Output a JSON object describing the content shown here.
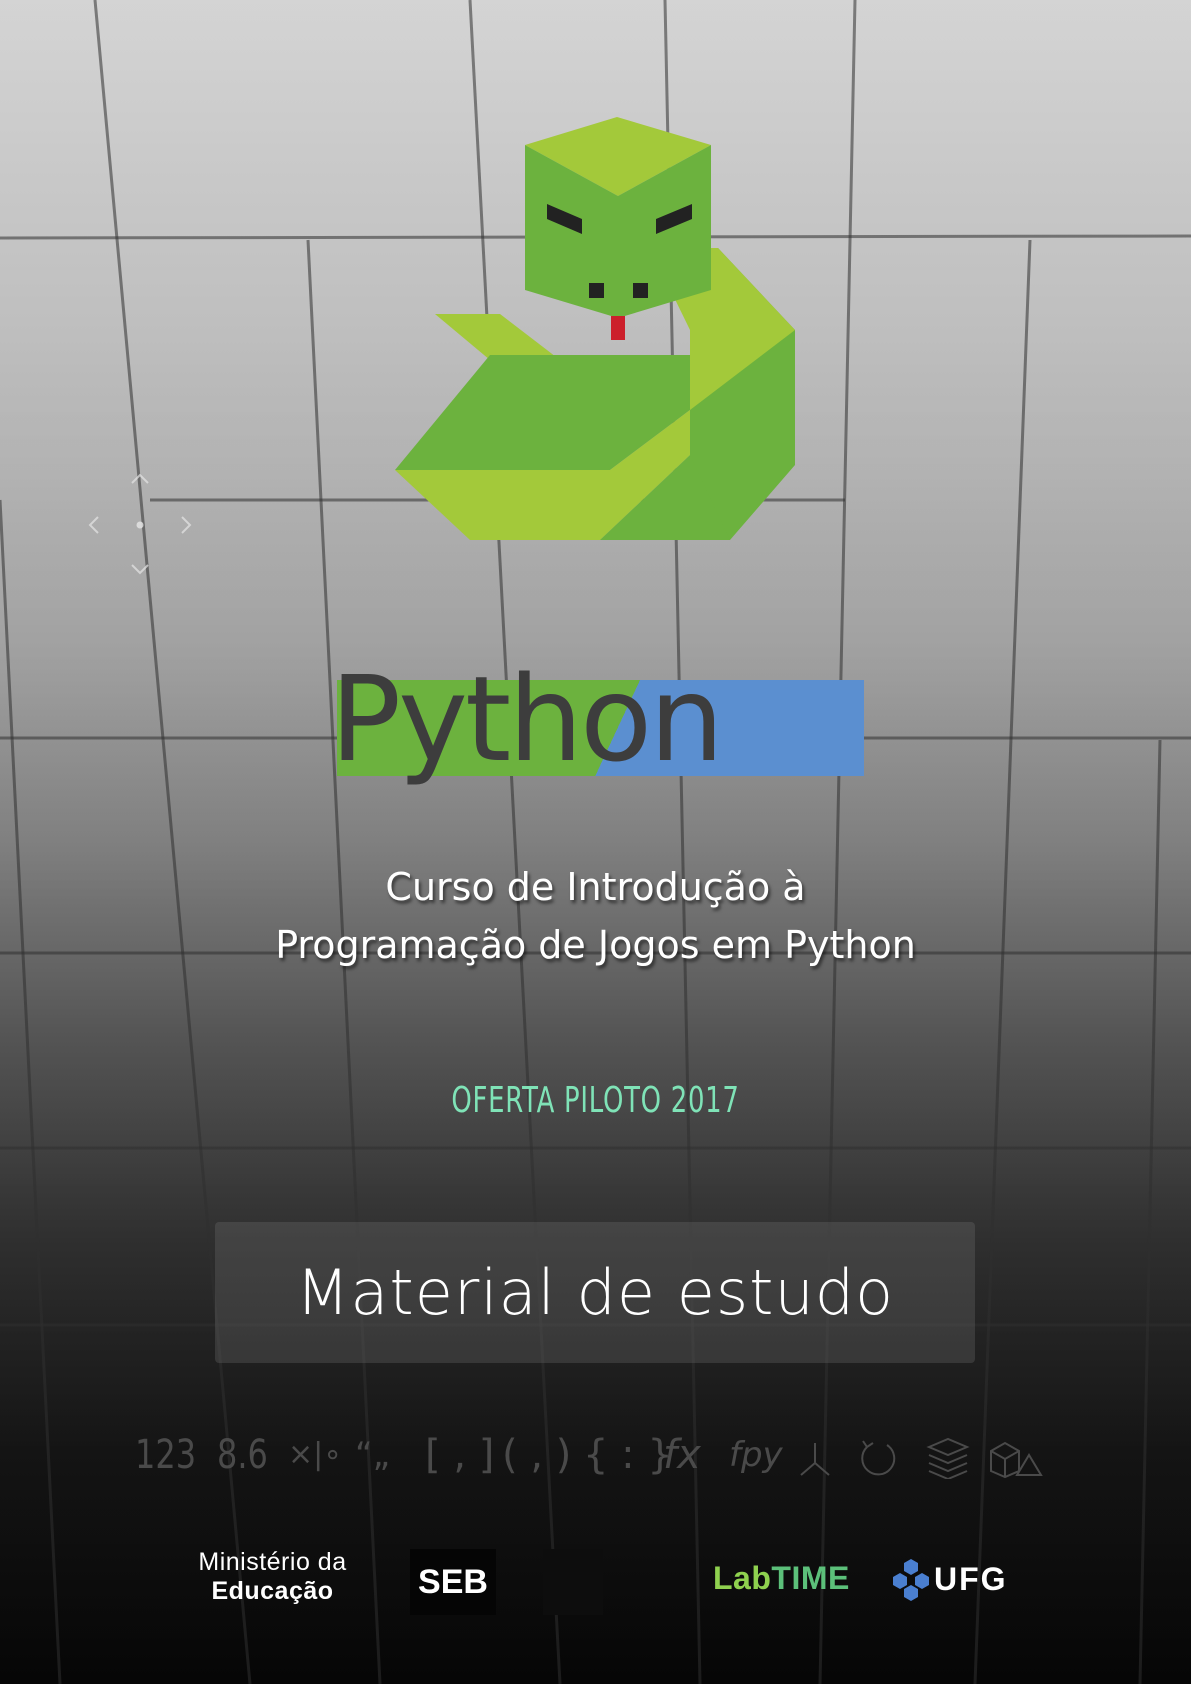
{
  "cover": {
    "wordmark": "Python",
    "course_title_line1": "Curso de Introdução à",
    "course_title_line2": "Programação de Jogos em Python",
    "edition": "OFERTA PILOTO 2017",
    "material_label": "Material de estudo"
  },
  "nav_control": {
    "up": "chevron-up-icon",
    "down": "chevron-down-icon",
    "left": "chevron-left-icon",
    "right": "chevron-right-icon",
    "center": "dot-icon"
  },
  "symbols": [
    {
      "label": "123",
      "icon": "integer-icon"
    },
    {
      "label": "8.6",
      "icon": "float-icon"
    },
    {
      "label": "×|∘",
      "icon": "operators-icon"
    },
    {
      "label": "“”",
      "icon": "string-icon"
    },
    {
      "label": "[ , ]",
      "icon": "list-icon"
    },
    {
      "label": "( , )",
      "icon": "tuple-icon"
    },
    {
      "label": "{ : }",
      "icon": "dict-icon"
    },
    {
      "label": "fx",
      "icon": "function-icon"
    },
    {
      "label": "fpy",
      "icon": "python-function-icon"
    },
    {
      "label": "branch",
      "icon": "branch-icon"
    },
    {
      "label": "loop",
      "icon": "loop-icon"
    },
    {
      "label": "stack",
      "icon": "stack-icon"
    },
    {
      "label": "shapes",
      "icon": "shapes-icon"
    }
  ],
  "footer": {
    "ministry_line1": "Ministério da",
    "ministry_line2": "Educação",
    "seb": "SEB",
    "labtime_lab": "Lab",
    "labtime_time": "TIME",
    "ufg": "UFG"
  },
  "colors": {
    "snake_green_dark": "#6cb23e",
    "snake_green_light": "#a3c93a",
    "python_blue": "#5b8fd0",
    "edition_mint": "#7fe3b7",
    "tongue_red": "#cc1f2b"
  }
}
